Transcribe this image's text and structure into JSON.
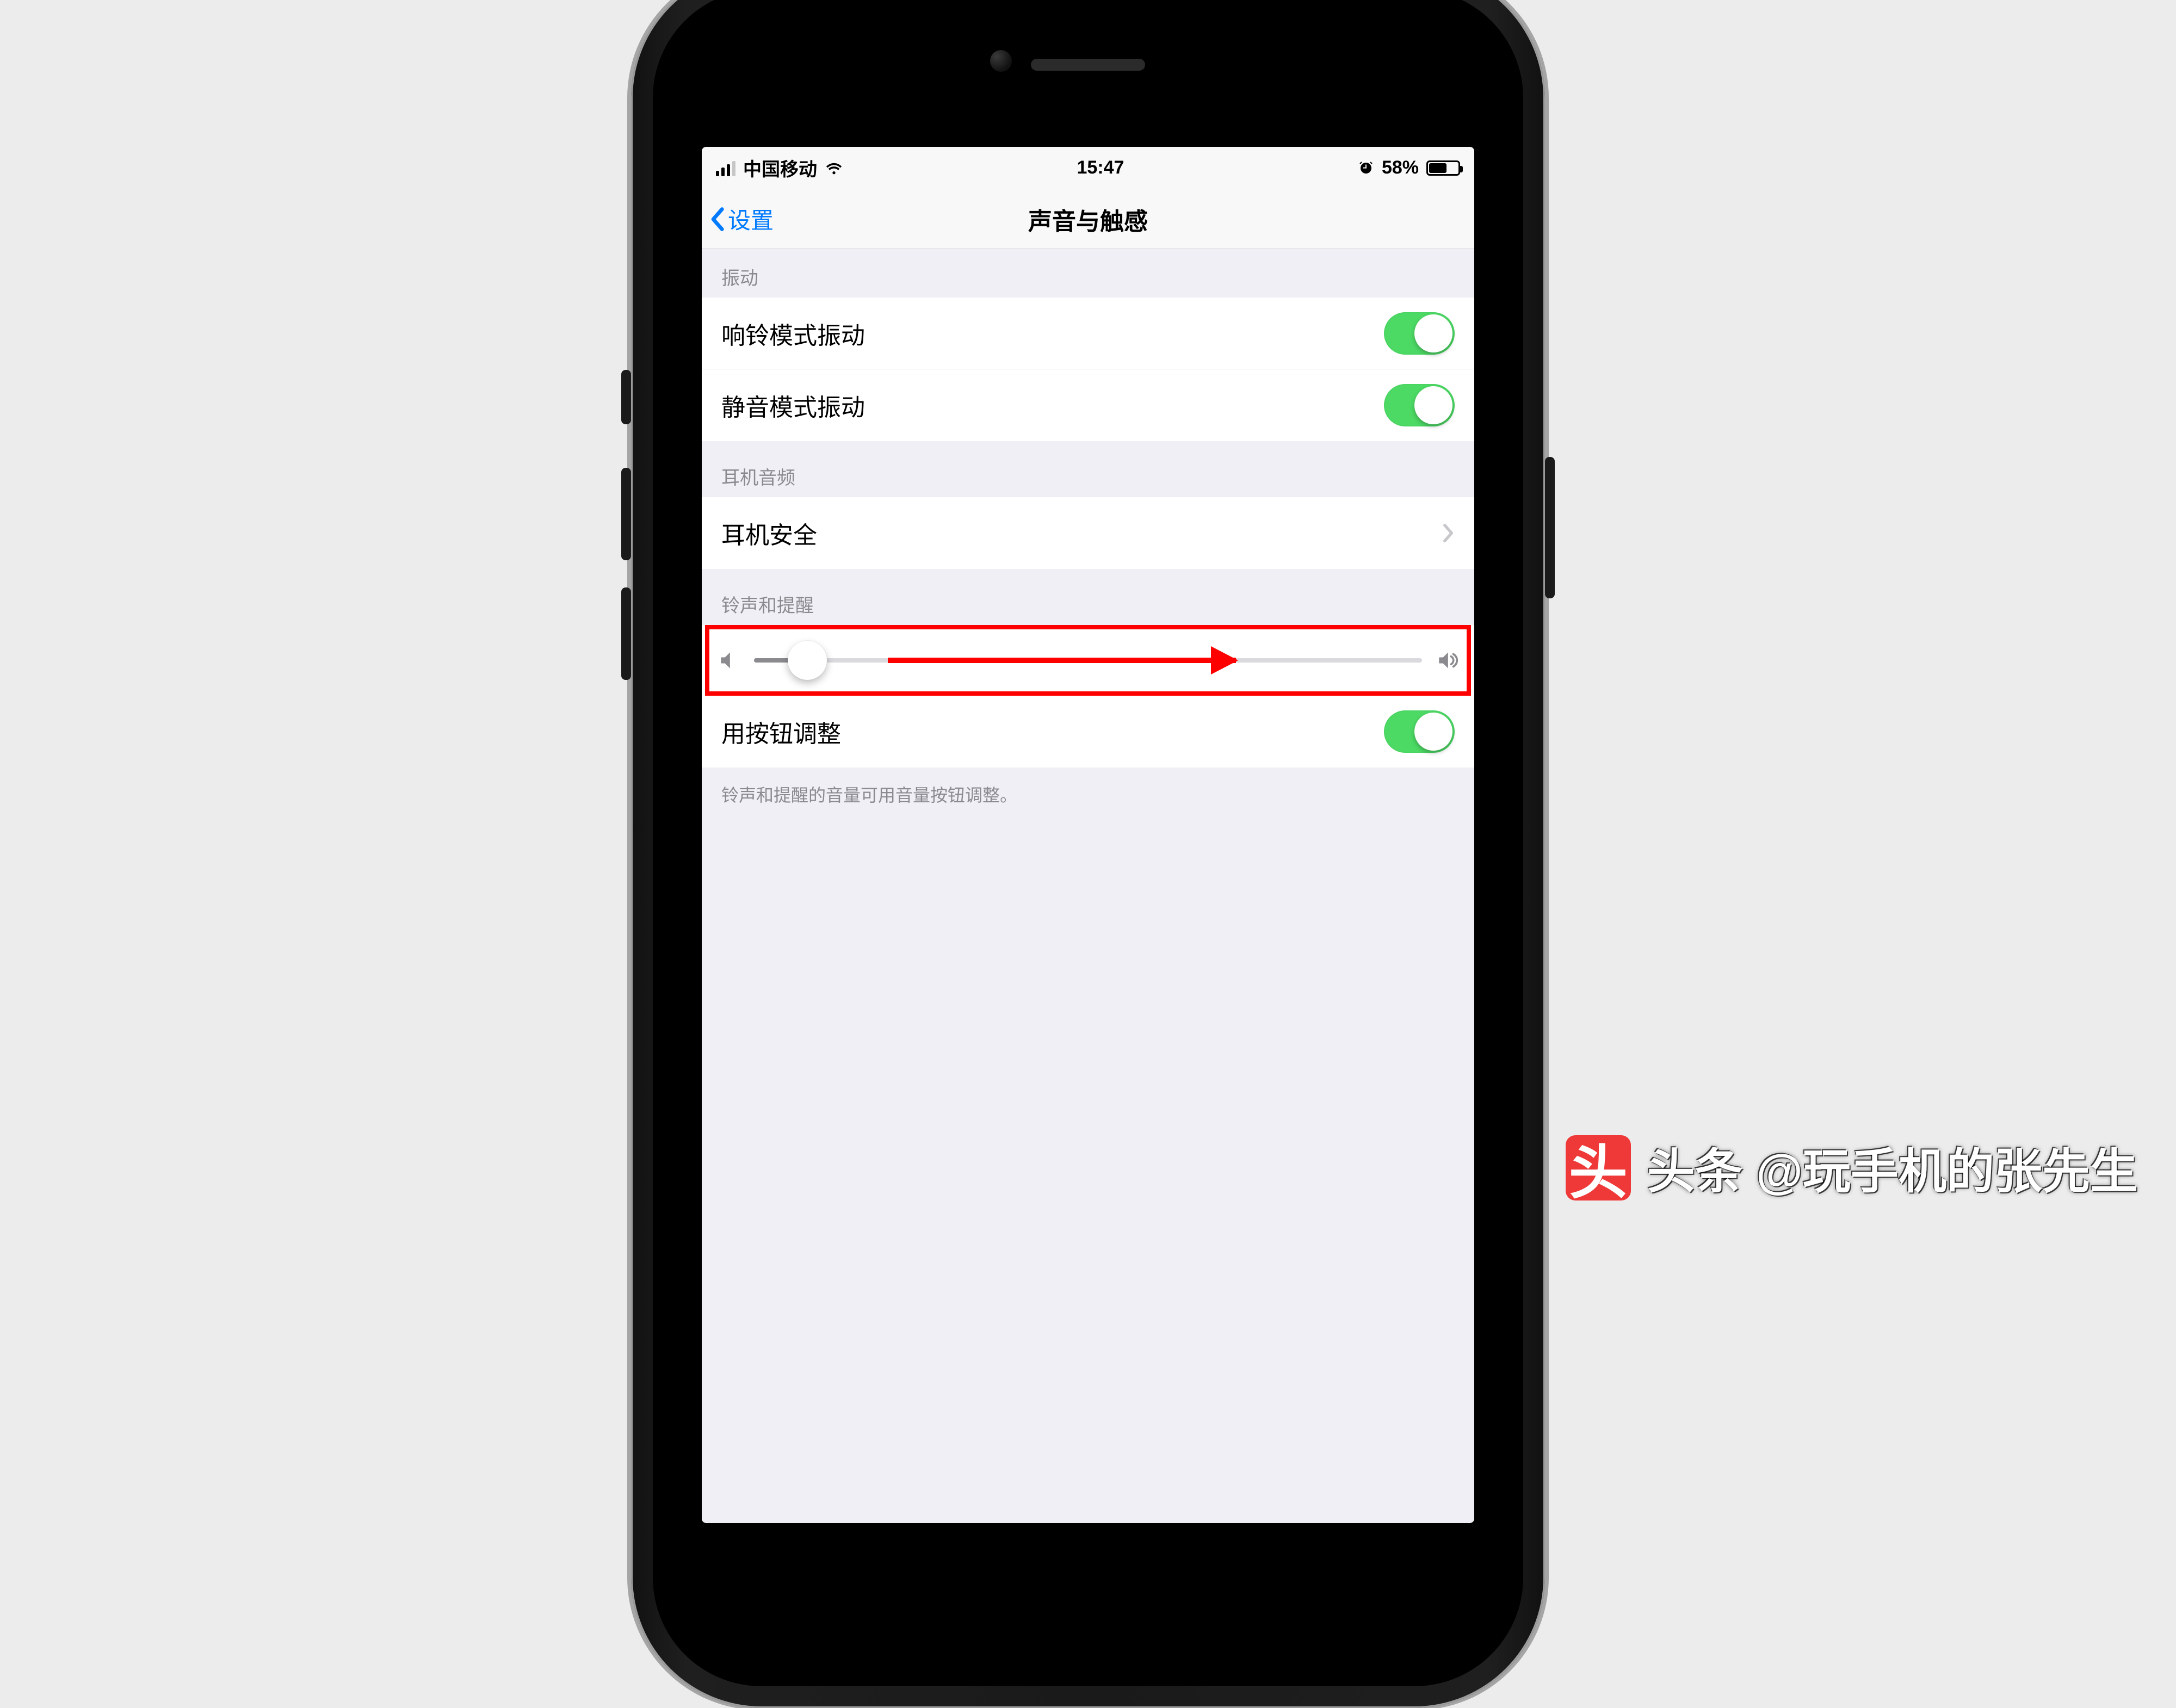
{
  "statusbar": {
    "carrier": "中国移动",
    "time": "15:47",
    "battery_percent": "58%",
    "battery_level": 58
  },
  "nav": {
    "back_label": "设置",
    "title": "声音与触感"
  },
  "sections": {
    "vibration": {
      "header": "振动",
      "ring_vibrate": {
        "label": "响铃模式振动",
        "on": true
      },
      "silent_vibrate": {
        "label": "静音模式振动",
        "on": true
      }
    },
    "headphone": {
      "header": "耳机音频",
      "safety": {
        "label": "耳机安全"
      }
    },
    "ringer": {
      "header": "铃声和提醒",
      "volume_percent": 8,
      "change_with_buttons": {
        "label": "用按钮调整",
        "on": true
      },
      "footer": "铃声和提醒的音量可用音量按钮调整。"
    }
  },
  "watermark": {
    "badge": "头",
    "text": "头条 @玩手机的张先生"
  },
  "colors": {
    "ios_blue": "#007aff",
    "ios_green": "#4cd964",
    "highlight_red": "#ff0000",
    "section_bg": "#f0eff5",
    "secondary_text": "#8a8a8f"
  }
}
